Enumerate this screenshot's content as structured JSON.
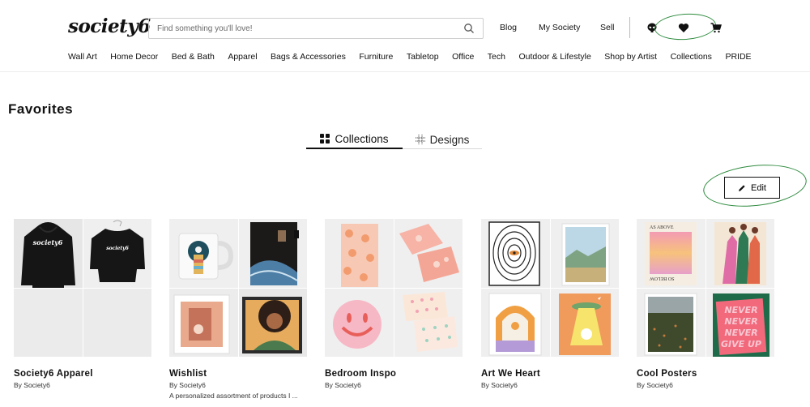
{
  "header": {
    "logo": "society6",
    "search_placeholder": "Find something you'll love!",
    "links": [
      "Blog",
      "My Society",
      "Sell"
    ]
  },
  "nav": [
    "Wall Art",
    "Home Decor",
    "Bed & Bath",
    "Apparel",
    "Bags & Accessories",
    "Furniture",
    "Tabletop",
    "Office",
    "Tech",
    "Outdoor & Lifestyle",
    "Shop by Artist",
    "Collections",
    "PRIDE"
  ],
  "page": {
    "title": "Favorites",
    "tabs": [
      {
        "label": "Collections",
        "active": true
      },
      {
        "label": "Designs",
        "active": false
      }
    ],
    "edit_label": "Edit"
  },
  "collections": [
    {
      "name": "Society6 Apparel",
      "by": "By Society6",
      "desc": ""
    },
    {
      "name": "Wishlist",
      "by": "By Society6",
      "desc": "A personalized assortment of products I ..."
    },
    {
      "name": "Bedroom Inspo",
      "by": "By Society6",
      "desc": ""
    },
    {
      "name": "Art We Heart",
      "by": "By Society6",
      "desc": ""
    },
    {
      "name": "Cool Posters",
      "by": "By Society6",
      "desc": ""
    }
  ],
  "thumb_text": {
    "apparel_print": "society6",
    "poster_above": "AS  ABOVE",
    "poster_below": "SO BELOW",
    "never_lines": [
      "NEVER",
      "NEVER",
      "NEVER",
      "GIVE UP"
    ]
  },
  "colors": {
    "accent_circle": "#2e8b3e",
    "text": "#111111"
  }
}
